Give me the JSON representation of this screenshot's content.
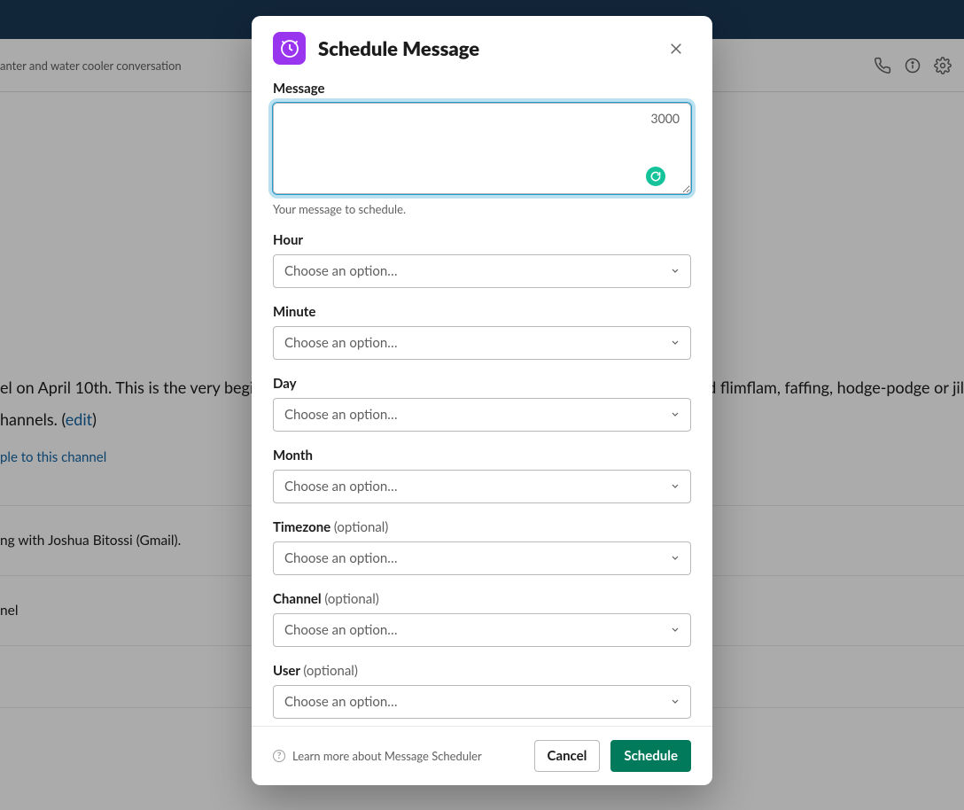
{
  "background": {
    "header_text": "anter and water cooler conversation",
    "para1_left": "el on April 10th. This is the very begin",
    "para1_right": "d flimflam, faffing, hodge-podge or jil",
    "para2_left": "hannels. (",
    "para2_edit": "edit",
    "para2_right": ")",
    "add_people": "ple to this channel",
    "line1": "ng with Joshua Bitossi (Gmail).",
    "line2": "nel"
  },
  "modal": {
    "title": "Schedule Message",
    "message": {
      "label": "Message",
      "char_counter": "3000",
      "hint": "Your message to schedule."
    },
    "hour": {
      "label": "Hour",
      "placeholder": "Choose an option…"
    },
    "minute": {
      "label": "Minute",
      "placeholder": "Choose an option…"
    },
    "day": {
      "label": "Day",
      "placeholder": "Choose an option…"
    },
    "month": {
      "label": "Month",
      "placeholder": "Choose an option…"
    },
    "timezone": {
      "label": "Timezone",
      "optional": "(optional)",
      "placeholder": "Choose an option…"
    },
    "channel": {
      "label": "Channel",
      "optional": "(optional)",
      "placeholder": "Choose an option…"
    },
    "user": {
      "label": "User",
      "optional": "(optional)",
      "placeholder": "Choose an option…"
    },
    "learn_more": "Learn more about Message Scheduler",
    "cancel": "Cancel",
    "submit": "Schedule"
  }
}
